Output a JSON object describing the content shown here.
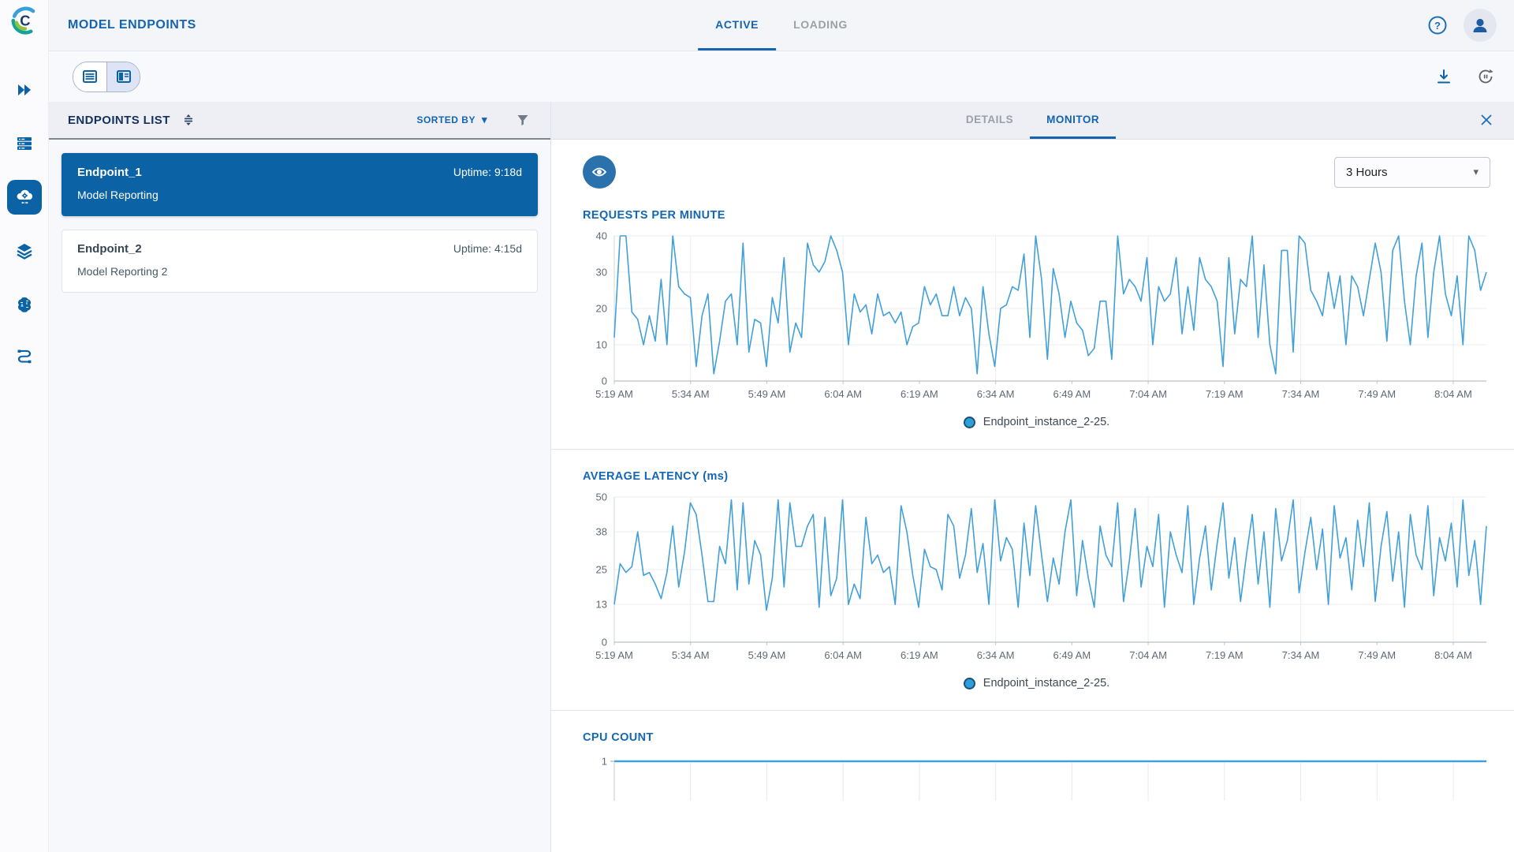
{
  "colors": {
    "primary_blue": "#1464b0",
    "selected_card_blue": "#0b63a5",
    "chart_line": "#41a0d9",
    "legend_dot": "#2e9fd9",
    "header_bg": "#f4f5f9",
    "panel_header_bg": "#edeff5",
    "panel_bg": "#f7f8fc"
  },
  "header": {
    "title": "MODEL ENDPOINTS",
    "tabs": [
      {
        "label": "ACTIVE",
        "active": true
      },
      {
        "label": "LOADING",
        "active": false
      }
    ]
  },
  "sidebar": {
    "items": [
      "runs",
      "datasets",
      "endpoints",
      "layers",
      "models",
      "flows"
    ],
    "active_item": "endpoints"
  },
  "endpoints_panel": {
    "title": "ENDPOINTS LIST",
    "sorted_by": "SORTED BY",
    "endpoints": [
      {
        "name": "Endpoint_1",
        "uptime": "Uptime: 9:18d",
        "subtitle": "Model Reporting",
        "selected": true
      },
      {
        "name": "Endpoint_2",
        "uptime": "Uptime: 4:15d",
        "subtitle": "Model Reporting 2",
        "selected": false
      }
    ]
  },
  "monitor_panel": {
    "tabs": [
      {
        "label": "DETAILS",
        "active": false
      },
      {
        "label": "MONITOR",
        "active": true
      }
    ],
    "time_range": "3 Hours",
    "legend_label": "Endpoint_instance_2-25."
  },
  "chart_data": [
    {
      "type": "line",
      "title": "REQUESTS PER MINUTE",
      "x_labels": [
        "5:19 AM",
        "5:34 AM",
        "5:49 AM",
        "6:04 AM",
        "6:19 AM",
        "6:34 AM",
        "6:49 AM",
        "7:04 AM",
        "7:19 AM",
        "7:34 AM",
        "7:49 AM",
        "8:04 AM"
      ],
      "values": [
        12,
        40,
        40,
        19,
        17,
        10,
        18,
        11,
        28,
        10,
        40,
        26,
        24,
        23,
        4,
        18,
        24,
        2,
        11,
        22,
        24,
        10,
        38,
        8,
        17,
        16,
        4,
        23,
        16,
        34,
        8,
        16,
        12,
        38,
        32,
        30,
        33,
        40,
        36,
        30,
        10,
        24,
        19,
        21,
        13,
        24,
        18,
        19,
        16,
        19,
        10,
        15,
        16,
        26,
        21,
        24,
        18,
        18,
        26,
        18,
        23,
        20,
        2,
        26,
        13,
        4,
        20,
        21,
        26,
        25,
        35,
        12,
        40,
        28,
        6,
        31,
        24,
        12,
        22,
        16,
        14,
        7,
        9,
        22,
        22,
        6,
        40,
        24,
        28,
        26,
        22,
        34,
        10,
        26,
        22,
        24,
        34,
        13,
        26,
        14,
        34,
        28,
        26,
        22,
        4,
        34,
        13,
        28,
        26,
        40,
        12,
        32,
        10,
        2,
        36,
        36,
        8,
        40,
        38,
        25,
        22,
        18,
        30,
        20,
        29,
        10,
        29,
        26,
        18,
        28,
        38,
        30,
        11,
        36,
        40,
        22,
        10,
        29,
        38,
        12,
        30,
        40,
        24,
        18,
        29,
        10,
        40,
        36,
        25,
        30
      ],
      "ylim": [
        0,
        40
      ],
      "yticks": [
        0,
        10,
        20,
        30,
        40
      ],
      "grid": true,
      "legend": [
        "Endpoint_instance_2-25."
      ],
      "legend_position": "bottom-center"
    },
    {
      "type": "line",
      "title": "AVERAGE LATENCY (ms)",
      "x_labels": [
        "5:19 AM",
        "5:34 AM",
        "5:49 AM",
        "6:04 AM",
        "6:19 AM",
        "6:34 AM",
        "6:49 AM",
        "7:04 AM",
        "7:19 AM",
        "7:34 AM",
        "7:49 AM",
        "8:04 AM"
      ],
      "values": [
        13,
        27,
        24,
        26,
        38,
        23,
        24,
        20,
        15,
        24,
        40,
        19,
        31,
        48,
        44,
        30,
        14,
        14,
        33,
        27,
        49,
        18,
        48,
        20,
        35,
        30,
        11,
        22,
        49,
        19,
        48,
        33,
        33,
        40,
        44,
        12,
        43,
        16,
        22,
        49,
        13,
        20,
        15,
        43,
        27,
        30,
        24,
        26,
        13,
        47,
        38,
        23,
        12,
        32,
        26,
        25,
        18,
        44,
        40,
        22,
        30,
        46,
        24,
        34,
        13,
        49,
        28,
        36,
        32,
        12,
        41,
        23,
        47,
        30,
        14,
        29,
        20,
        38,
        49,
        16,
        35,
        22,
        12,
        40,
        30,
        26,
        48,
        14,
        28,
        46,
        19,
        33,
        26,
        44,
        12,
        38,
        30,
        24,
        47,
        13,
        29,
        40,
        18,
        34,
        48,
        22,
        36,
        14,
        30,
        44,
        20,
        38,
        12,
        46,
        28,
        35,
        49,
        17,
        31,
        43,
        25,
        39,
        13,
        47,
        29,
        36,
        18,
        42,
        26,
        48,
        14,
        33,
        45,
        21,
        38,
        12,
        44,
        30,
        25,
        47,
        16,
        36,
        28,
        41,
        19,
        49,
        23,
        35,
        13,
        40
      ],
      "ylim": [
        0,
        50
      ],
      "yticks": [
        0,
        13,
        25,
        38,
        50
      ],
      "grid": true,
      "legend": [
        "Endpoint_instance_2-25."
      ],
      "legend_position": "bottom-center"
    },
    {
      "type": "line",
      "title": "CPU COUNT",
      "values": [
        1,
        1
      ],
      "ylim": [
        0,
        1
      ],
      "yticks": [
        1
      ],
      "partial": true
    }
  ]
}
